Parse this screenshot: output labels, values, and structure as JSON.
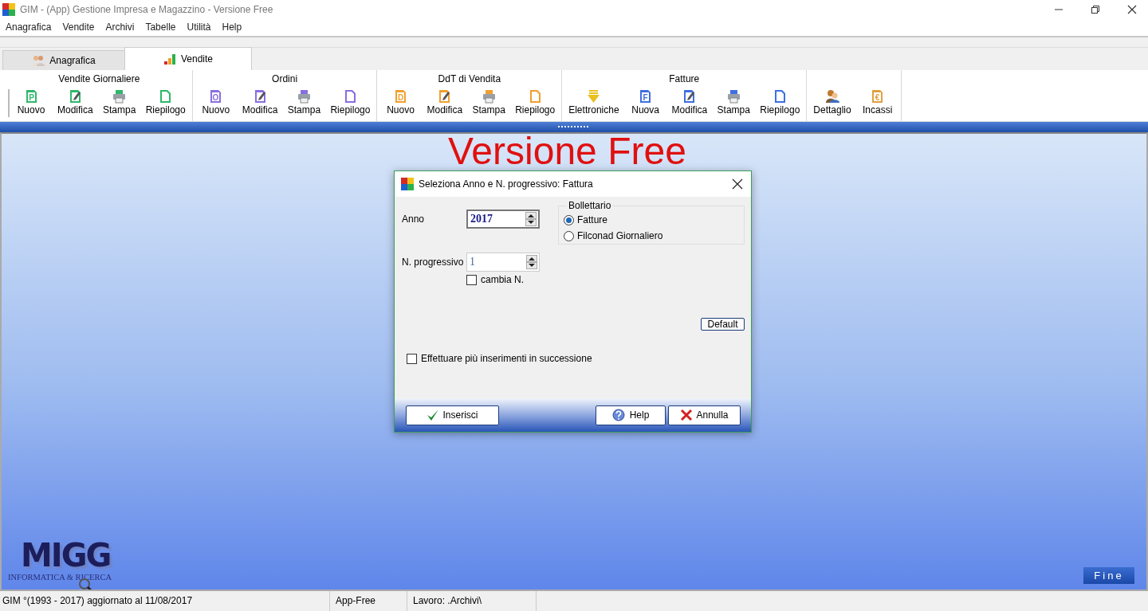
{
  "window": {
    "title": "GIM  - (App) Gestione Impresa e Magazzino - Versione Free"
  },
  "menu": [
    "Anagrafica",
    "Vendite",
    "Archivi",
    "Tabelle",
    "Utilità",
    "Help"
  ],
  "tabs": [
    {
      "label": "Anagrafica",
      "kind": "people",
      "selected": false
    },
    {
      "label": "Vendite",
      "kind": "bars",
      "selected": true
    }
  ],
  "toolbar": [
    {
      "title": "Vendite Giornaliere",
      "buttons": [
        {
          "label": "Nuovo",
          "kind": "letter",
          "glyph": "P",
          "color": "#2fb86a"
        },
        {
          "label": "Modifica",
          "kind": "edit",
          "color": "#2fb86a"
        },
        {
          "label": "Stampa",
          "kind": "print",
          "color": "#2fb86a"
        },
        {
          "label": "Riepilogo",
          "kind": "page",
          "color": "#2fb86a"
        }
      ]
    },
    {
      "title": "Ordini",
      "buttons": [
        {
          "label": "Nuovo",
          "kind": "letter",
          "glyph": "O",
          "color": "#8a6ee0"
        },
        {
          "label": "Modifica",
          "kind": "edit",
          "color": "#8a6ee0"
        },
        {
          "label": "Stampa",
          "kind": "print",
          "color": "#8a6ee0"
        },
        {
          "label": "Riepilogo",
          "kind": "page",
          "color": "#8a6ee0"
        }
      ]
    },
    {
      "title": "DdT di Vendita",
      "buttons": [
        {
          "label": "Nuovo",
          "kind": "letter",
          "glyph": "D",
          "color": "#f0a030"
        },
        {
          "label": "Modifica",
          "kind": "edit",
          "color": "#f0a030"
        },
        {
          "label": "Stampa",
          "kind": "print",
          "color": "#f0a030"
        },
        {
          "label": "Riepilogo",
          "kind": "page",
          "color": "#f0a030"
        }
      ]
    },
    {
      "title": "Fatture",
      "buttons": [
        {
          "label": "Elettroniche",
          "kind": "download",
          "color": "#e8c020"
        },
        {
          "label": "Nuova",
          "kind": "letter",
          "glyph": "F",
          "color": "#3f6fe0"
        },
        {
          "label": "Modifica",
          "kind": "edit",
          "color": "#3f6fe0"
        },
        {
          "label": "Stampa",
          "kind": "print",
          "color": "#3f6fe0"
        },
        {
          "label": "Riepilogo",
          "kind": "page",
          "color": "#3f6fe0"
        }
      ]
    },
    {
      "buttons": [
        {
          "label": "Dettaglio",
          "kind": "people",
          "color": "#c07a30"
        },
        {
          "label": "Incassi",
          "kind": "letter",
          "glyph": "€",
          "color": "#e0a040"
        }
      ]
    }
  ],
  "background": {
    "watermark": "Versione Free",
    "logo": "MIGG",
    "logo_caption": "INFORMATICA & RICERCA",
    "exit_button": "Fine"
  },
  "dialog": {
    "title": "Seleziona Anno e N. progressivo: Fattura",
    "anno": {
      "label": "Anno",
      "value": "2017"
    },
    "progressivo": {
      "label": "N. progressivo",
      "value": "1"
    },
    "change_number": {
      "label": "cambia N.",
      "checked": false
    },
    "group": {
      "title": "Bollettario",
      "options": [
        {
          "label": "Fatture",
          "selected": true
        },
        {
          "label": "Filconad Giornaliero",
          "selected": false
        }
      ]
    },
    "default_button": "Default",
    "repeat": {
      "label": "Effettuare più inserimenti in successione",
      "checked": false
    },
    "buttons": [
      {
        "label": "Inserisci",
        "kind": "ok"
      },
      {
        "label": "Help",
        "kind": "help"
      },
      {
        "label": "Annulla",
        "kind": "cancel"
      }
    ]
  },
  "status_bar": [
    "GIM °(1993 - 2017)  aggiornato al 11/08/2017",
    "App-Free",
    "Lavoro: .Archivi\\"
  ]
}
